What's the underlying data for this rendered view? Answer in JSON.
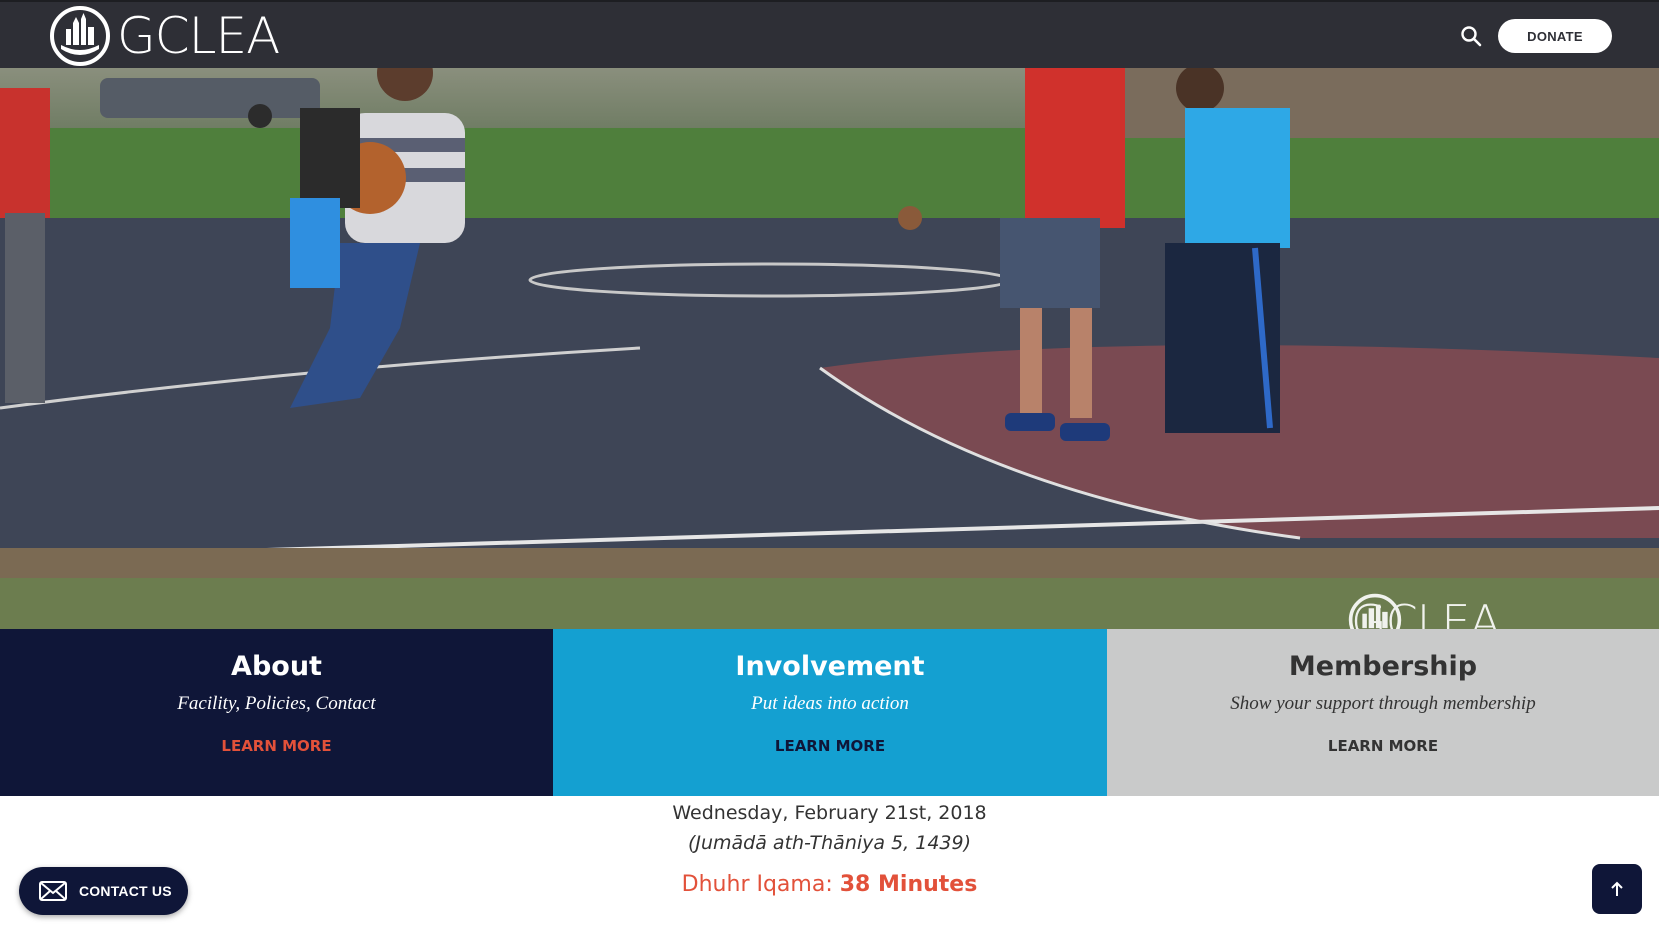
{
  "header": {
    "logo_text": "GCLEA",
    "donate_label": "DONATE"
  },
  "hero": {
    "watermark_text": "GCLEA",
    "image_description_icon": "basketball-court-scene"
  },
  "tiles": [
    {
      "title": "About",
      "subtitle": "Facility, Policies, Contact",
      "link": "LEARN MORE",
      "bg": "#0f1638",
      "link_color": "#e2513a"
    },
    {
      "title": "Involvement",
      "subtitle": "Put ideas into action",
      "link": "LEARN MORE",
      "bg": "#14a0d1",
      "link_color": "#0f1638"
    },
    {
      "title": "Membership",
      "subtitle": "Show your support through membership",
      "link": "LEARN MORE",
      "bg": "#c9caca",
      "link_color": "#333333"
    }
  ],
  "date": {
    "gregorian": "Wednesday, February 21st, 2018",
    "hijri": "(Jumādā ath-Thāniya 5, 1439)",
    "iqama_label": "Dhuhr Iqama:",
    "iqama_value": "38 Minutes"
  },
  "floating": {
    "contact_label": "CONTACT US"
  },
  "colors": {
    "header_bg": "#2e2f36",
    "navy": "#0f1638",
    "blue": "#14a0d1",
    "grey": "#c9caca",
    "accent_red": "#e2513a"
  }
}
